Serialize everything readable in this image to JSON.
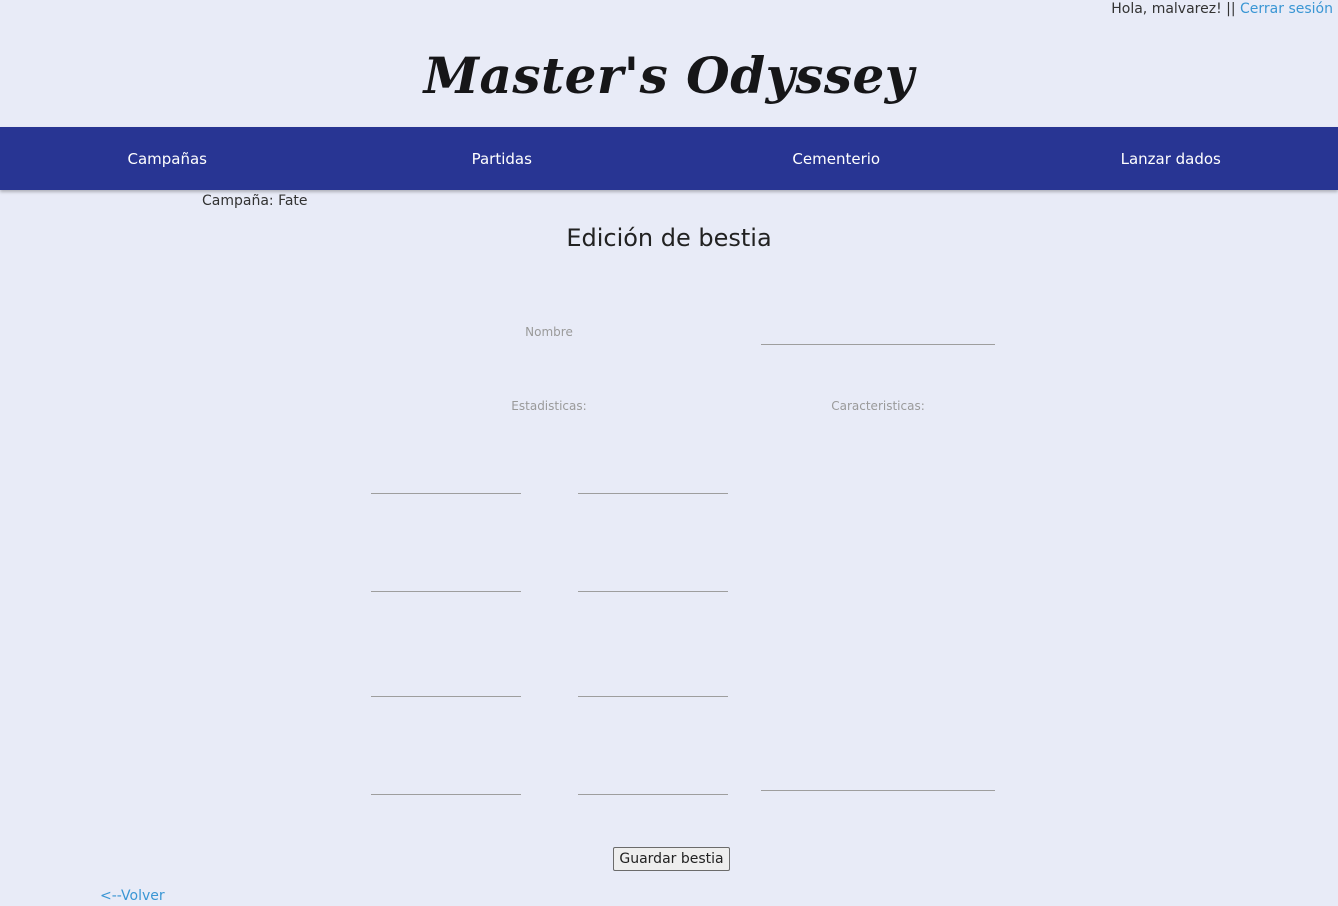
{
  "header": {
    "greeting": "Hola, malvarez! || ",
    "logout_label": "Cerrar sesión",
    "site_title": "Master's Odyssey"
  },
  "nav": {
    "items": [
      {
        "label": "Campañas"
      },
      {
        "label": "Partidas"
      },
      {
        "label": "Cementerio"
      },
      {
        "label": "Lanzar dados"
      }
    ]
  },
  "campaign": {
    "label": "Campaña: Fate"
  },
  "form": {
    "title": "Edición de bestia",
    "name_label": "Nombre",
    "name_value": "",
    "stats_label": "Estadisticas:",
    "traits_label": "Caracteristicas:",
    "stat_values": [
      "",
      "",
      "",
      "",
      "",
      "",
      "",
      ""
    ],
    "traits_value": "",
    "save_label": "Guardar bestia"
  },
  "footer": {
    "back_label": "<--Volver"
  },
  "colors": {
    "navbar": "#283593",
    "background": "#e8ebf7",
    "link": "#3a96d4"
  }
}
